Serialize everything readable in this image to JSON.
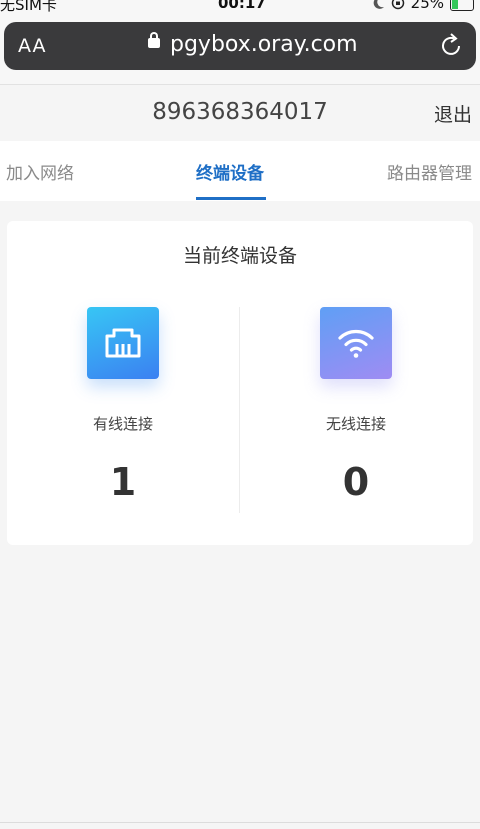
{
  "status_bar": {
    "carrier": "无SIM卡",
    "time": "00:17",
    "battery": "25%",
    "battery_level": 0.25
  },
  "browser": {
    "text_size_label": "AA",
    "url": "pgybox.oray.com"
  },
  "header": {
    "account_id": "896368364017",
    "logout_label": "退出"
  },
  "tabs": [
    {
      "label": "加入网络",
      "active": false
    },
    {
      "label": "终端设备",
      "active": true
    },
    {
      "label": "路由器管理",
      "active": false
    }
  ],
  "devices": {
    "title": "当前终端设备",
    "wired": {
      "label": "有线连接",
      "count": "1",
      "icon": "ethernet-icon"
    },
    "wireless": {
      "label": "无线连接",
      "count": "0",
      "icon": "wifi-icon"
    }
  },
  "colors": {
    "accent": "#1f6fc6",
    "wired_gradient": [
      "#37c6f4",
      "#3b80f2"
    ],
    "wireless_gradient": [
      "#5f9ff5",
      "#9f8cf3"
    ]
  }
}
